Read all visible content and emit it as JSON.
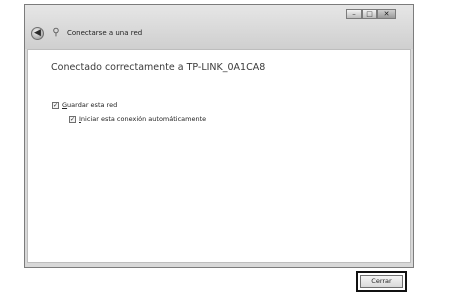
{
  "window": {
    "title": "Conectarse a una red",
    "controls": {
      "minimize": "–",
      "maximize": "□",
      "close": "✕"
    }
  },
  "content": {
    "heading": "Conectado correctamente a TP-LINK_0A1CA8",
    "checkboxes": [
      {
        "label_accel": "G",
        "label_rest": "uardar esta red",
        "checked": true
      },
      {
        "label_accel": "I",
        "label_rest": "niciar esta conexión automáticamente",
        "checked": true
      }
    ]
  },
  "footer": {
    "close_label": "Cerrar"
  },
  "icons": {
    "back": "back-arrow-icon",
    "network": "wireless-network-icon"
  }
}
